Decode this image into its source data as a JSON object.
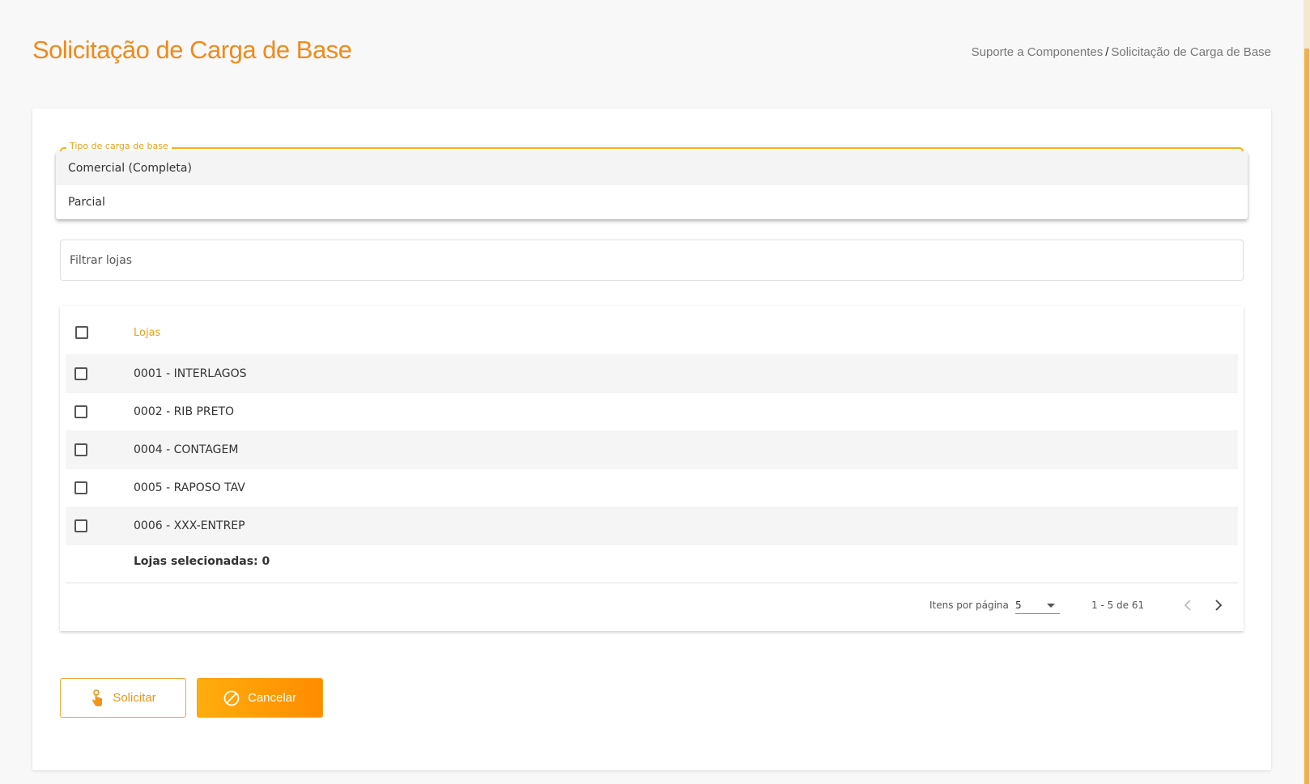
{
  "header": {
    "title": "Solicitação de Carga de Base",
    "breadcrumb": {
      "parent": "Suporte a Componentes",
      "separator": "/",
      "current": "Solicitação de Carga de Base"
    }
  },
  "form": {
    "select": {
      "label": "Tipo de carga de base",
      "options": [
        "Comercial (Completa)",
        "Parcial"
      ]
    },
    "filter": {
      "placeholder": "Filtrar lojas",
      "value": ""
    }
  },
  "table": {
    "column_header": "Lojas",
    "rows": [
      "0001 - INTERLAGOS",
      "0002 - RIB PRETO",
      "0004 - CONTAGEM",
      "0005 - RAPOSO TAV",
      "0006 - XXX-ENTREP"
    ],
    "selected_summary": "Lojas selecionadas: 0"
  },
  "paginator": {
    "items_per_page_label": "Itens por página",
    "page_size": "5",
    "range_label": "1 - 5 de 61"
  },
  "actions": {
    "request_label": "Solicitar",
    "cancel_label": "Cancelar"
  },
  "colors": {
    "accent": "#f08a1c",
    "label_orange": "#e9a21a",
    "outline_yellow": "#f5b21a",
    "cancel_gradient_start": "#ffad0d",
    "cancel_gradient_end": "#ff8c00"
  },
  "icons": {
    "request": "touch-hand-icon",
    "cancel": "cancel-circle-icon",
    "prev": "chevron-left-icon",
    "next": "chevron-right-icon",
    "page_size_dropdown": "caret-down-icon"
  }
}
